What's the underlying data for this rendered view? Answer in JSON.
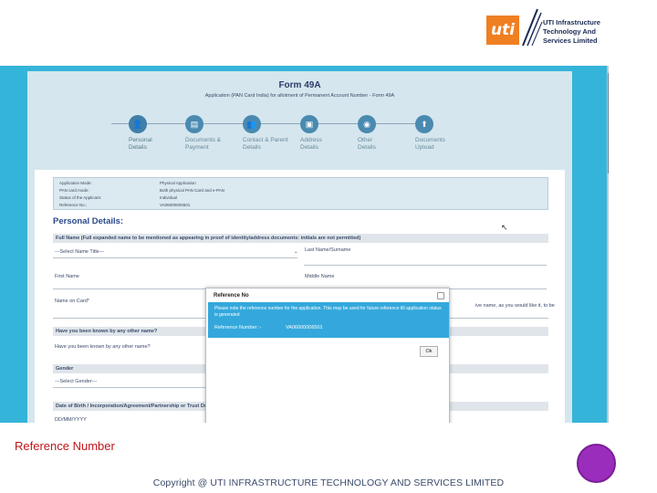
{
  "logo": {
    "mark": "uti",
    "line1": "UTI Infrastructure",
    "line2": "Technology And",
    "line3": "Services Limited",
    "color": "#f07f22"
  },
  "form": {
    "title": "Form 49A",
    "subtitle": "Application (PAN Card India) for allotment of Permanent Account Number - Form 49A",
    "steps": [
      {
        "icon": "user-icon",
        "glyph": "👤",
        "label": "Personal\nDetails"
      },
      {
        "icon": "document-icon",
        "glyph": "▤",
        "label": "Documents &\nPayment"
      },
      {
        "icon": "people-icon",
        "glyph": "👥",
        "label": "Contact & Parent\nDetails"
      },
      {
        "icon": "address-icon",
        "glyph": "▣",
        "label": "Address\nDetails"
      },
      {
        "icon": "other-icon",
        "glyph": "◉",
        "label": "Other\nDetails"
      },
      {
        "icon": "upload-icon",
        "glyph": "⬆",
        "label": "Documents\nUpload"
      }
    ],
    "info": [
      {
        "label": "Application Mode:",
        "value": "Physical Application"
      },
      {
        "label": "PAN card mode:",
        "value": "Both physical PAN Card and e-PAN"
      },
      {
        "label": "Status of the Applicant:",
        "value": "Individual"
      },
      {
        "label": "Reference No.:",
        "value": "VA06000006501"
      }
    ],
    "section_title": "Personal Details:",
    "full_name_bar": "Full Name (Full expanded name to be mentioned as appearing in proof of identity/address documents: initials are not permitted)",
    "select_title": "---Select Name Title---",
    "last_name": "Last Name/Surname",
    "first_name": "First Name",
    "middle_name": "Middle Name",
    "name_on_card": "Name on Card*",
    "name_on_card_hint": "ive name, as you would like it, to be",
    "known_bar": "Have you been known by any other name?",
    "known_field": "Have you been known by any other name?",
    "gender_bar": "Gender",
    "gender_select": "---Select Gender---",
    "dob_bar": "Date of Birth / Incorporation/Agreement/Partnership or Trust Deed/Formation of Body of Individuals/Association of Persons",
    "dob_field": "DD/MM/YYYY"
  },
  "dialog": {
    "title": "Reference No",
    "message": "Please note the reference number for the application. This may be used for future reference till application status is generated",
    "ref_label": "Reference Number :-",
    "ref_value": "VA06000006501",
    "ok_label": "Ok"
  },
  "caption": "Reference Number",
  "copyright": "Copyright @ UTI INFRASTRUCTURE TECHNOLOGY AND SERVICES LIMITED",
  "colors": {
    "backdrop": "#35b4d9",
    "caption": "#c0141a",
    "circle": "#9b2dbd"
  }
}
